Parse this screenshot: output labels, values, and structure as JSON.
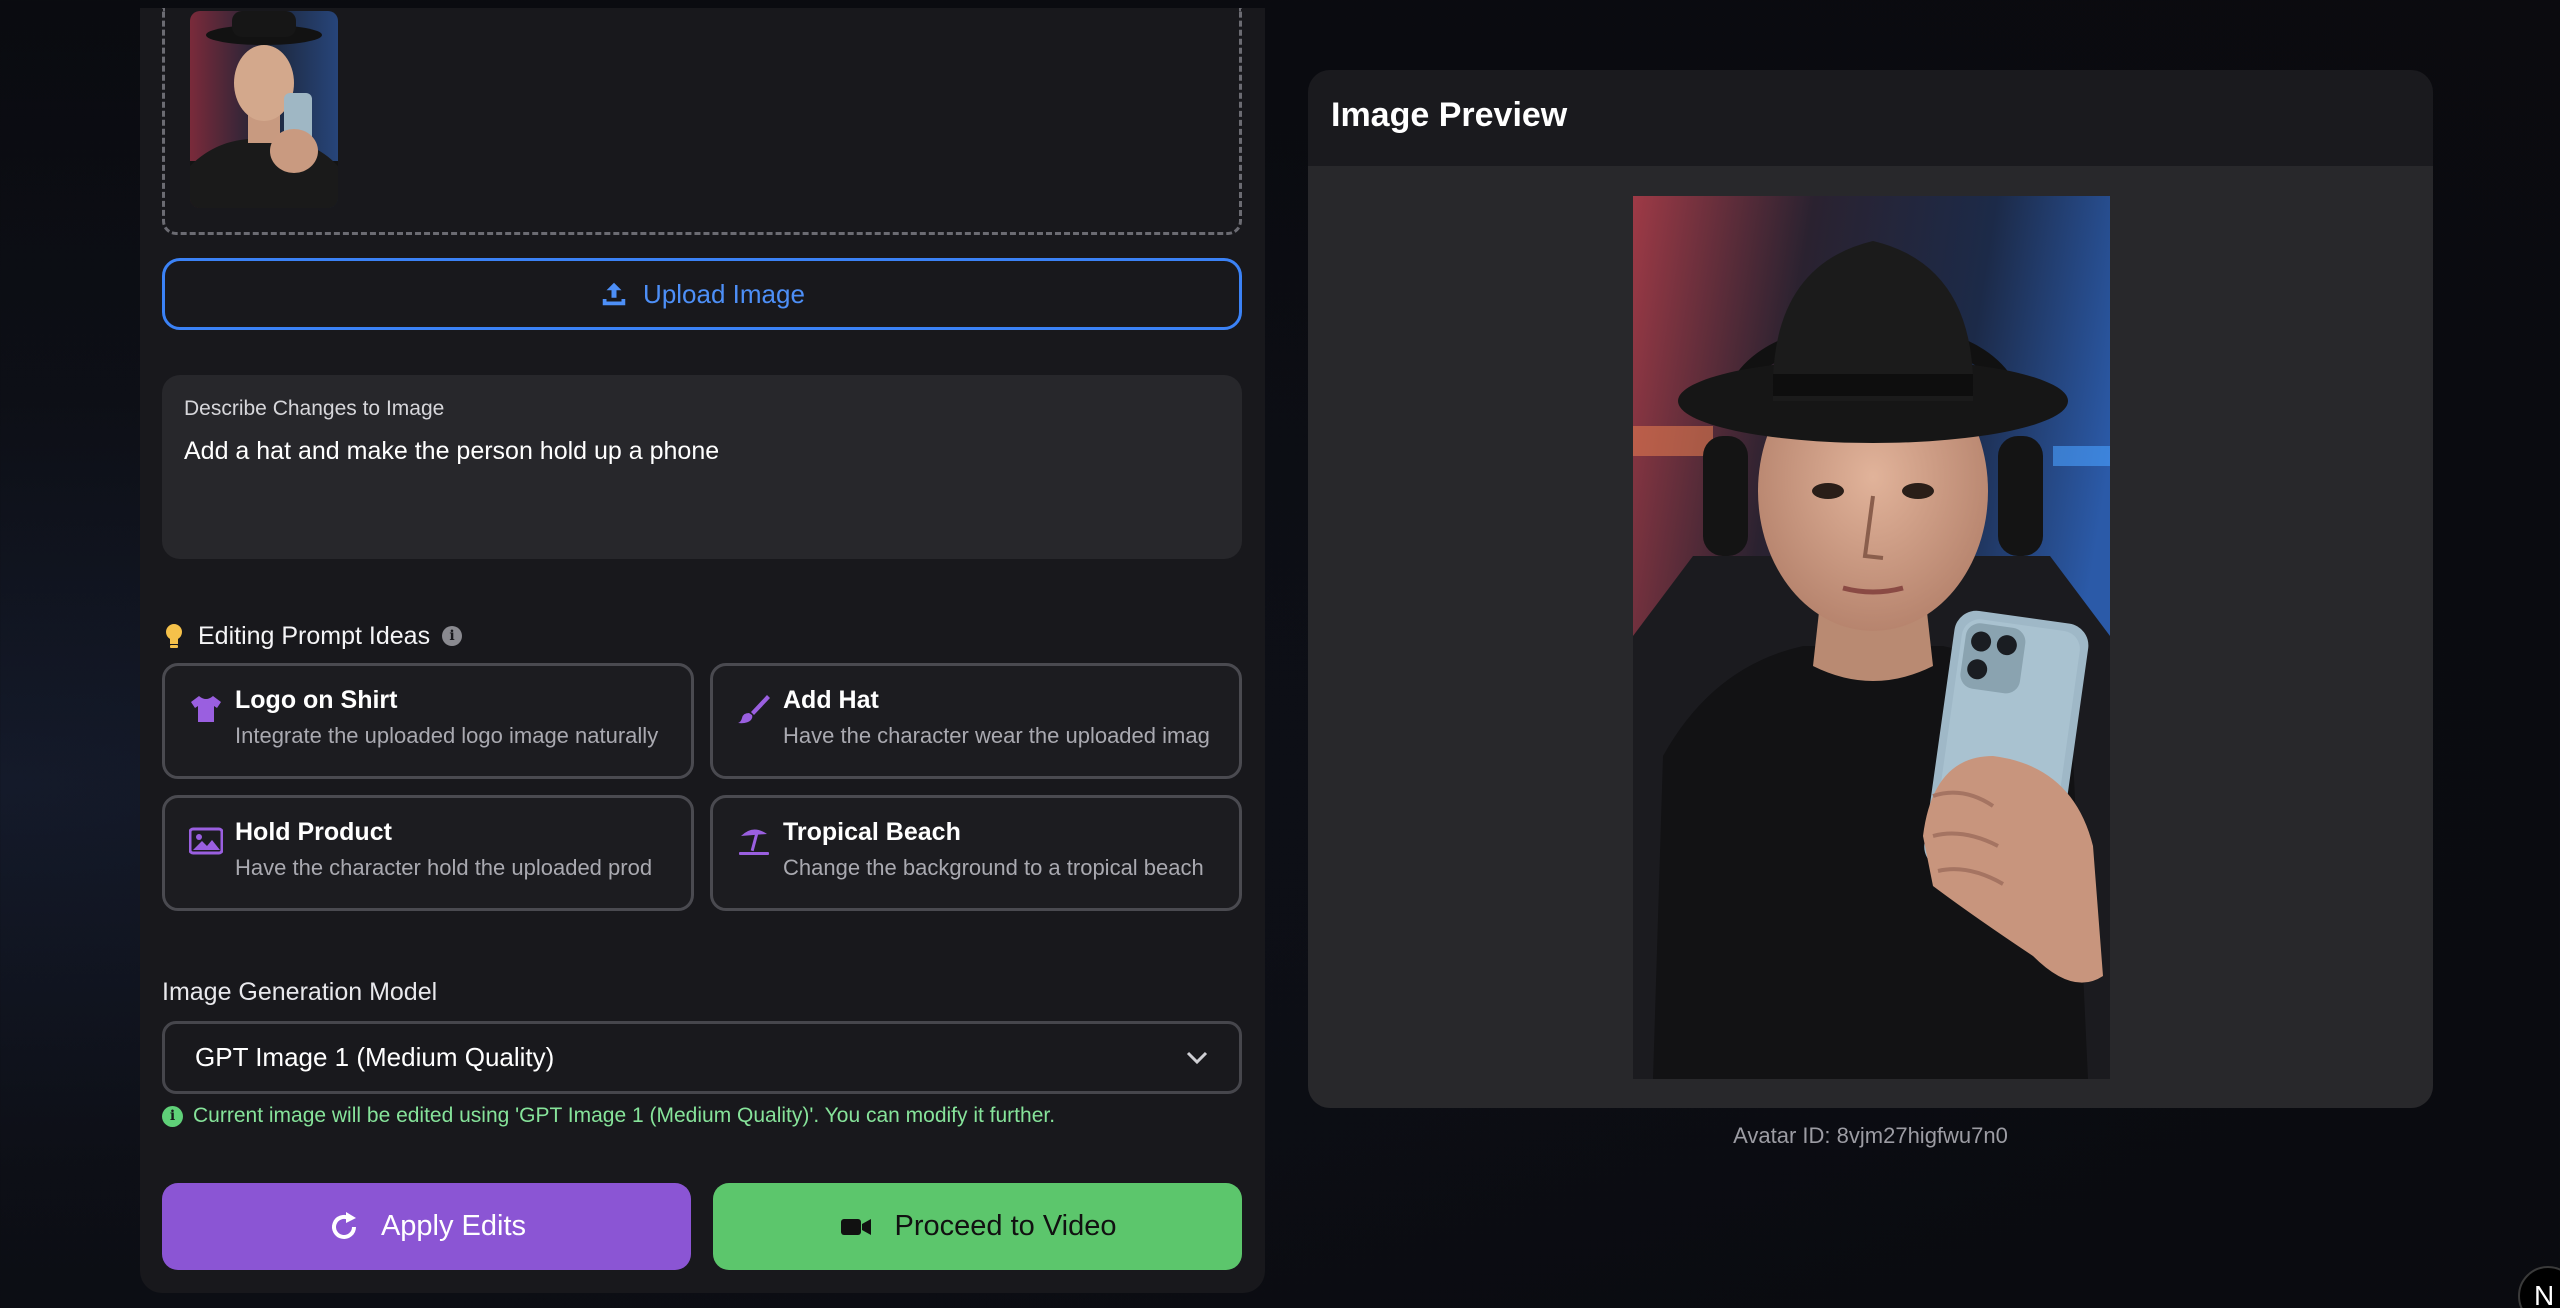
{
  "upload": {
    "button_label": "Upload Image"
  },
  "describe": {
    "label": "Describe Changes to Image",
    "value": "Add a hat and make the person hold up a phone"
  },
  "ideas": {
    "heading": "Editing Prompt Ideas",
    "items": [
      {
        "title": "Logo on Shirt",
        "description": "Integrate the uploaded logo image naturally",
        "icon": "shirt-icon"
      },
      {
        "title": "Add Hat",
        "description": "Have the character wear the uploaded imag",
        "icon": "brush-icon"
      },
      {
        "title": "Hold Product",
        "description": "Have the character hold the uploaded prod",
        "icon": "image-icon"
      },
      {
        "title": "Tropical Beach",
        "description": "Change the background to a tropical beach",
        "icon": "umbrella-beach-icon"
      }
    ]
  },
  "model": {
    "label": "Image Generation Model",
    "selected": "GPT Image 1 (Medium Quality)",
    "info": "Current image will be edited using 'GPT Image 1 (Medium Quality)'. You can modify it further."
  },
  "actions": {
    "apply_label": "Apply Edits",
    "video_label": "Proceed to Video"
  },
  "preview": {
    "title": "Image Preview",
    "avatar_id": "Avatar ID: 8vjm27higfwu7n0"
  },
  "corner_badge": "N",
  "colors": {
    "accent_blue": "#3b82f6",
    "apply_purple": "#8b55d4",
    "video_green": "#5cc66c",
    "info_green": "#86e39a",
    "idea_icon_purple": "#9a5fe0"
  }
}
